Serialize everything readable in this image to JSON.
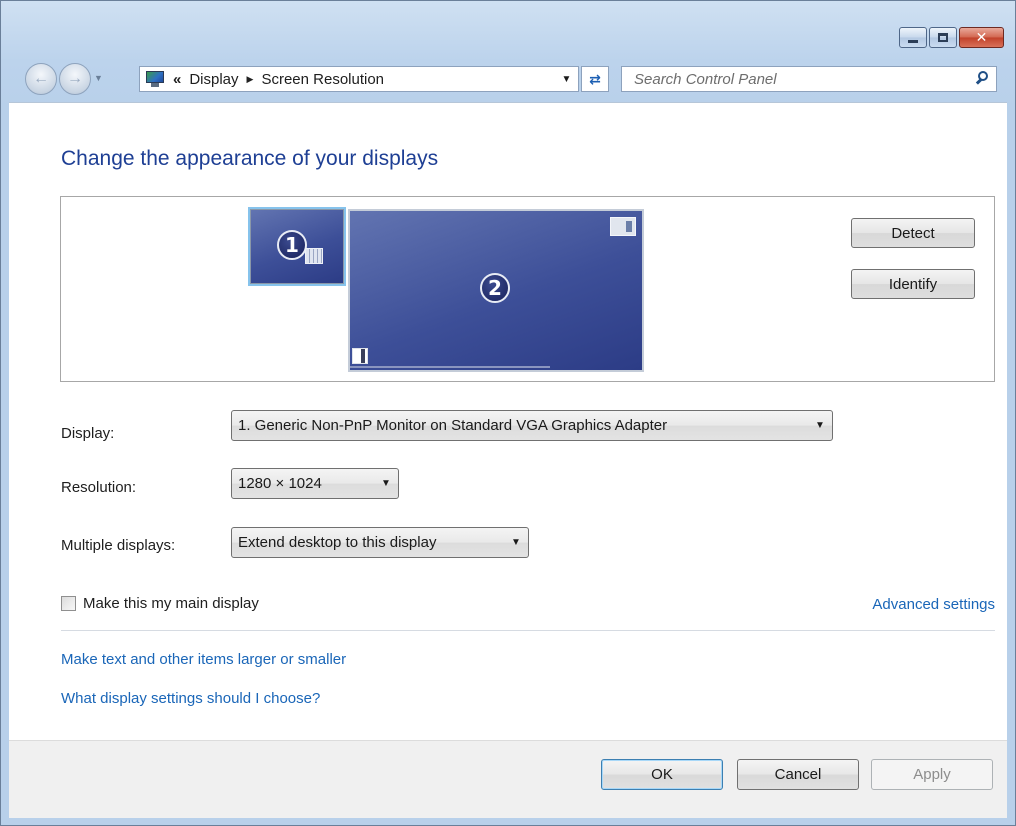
{
  "window": {
    "caption": {
      "close_glyph": "✕"
    }
  },
  "nav": {
    "breadcrumb_chevron": "«",
    "breadcrumbs": [
      "Display",
      "Screen Resolution"
    ],
    "search_placeholder": "Search Control Panel"
  },
  "main": {
    "title": "Change the appearance of your displays",
    "monitors": [
      {
        "number": "1"
      },
      {
        "number": "2"
      }
    ],
    "detect_label": "Detect",
    "identify_label": "Identify",
    "display": {
      "label": "Display:",
      "value": "1. Generic Non-PnP Monitor on Standard VGA Graphics Adapter"
    },
    "resolution": {
      "label": "Resolution:",
      "value": "1280 × 1024"
    },
    "multiple_displays": {
      "label": "Multiple displays:",
      "value": "Extend desktop to this display"
    },
    "main_display_checkbox": {
      "label": "Make this my main display",
      "checked": false
    },
    "advanced_settings_link": "Advanced settings",
    "links": [
      "Make text and other items larger or smaller",
      "What display settings should I choose?"
    ]
  },
  "footer": {
    "ok_label": "OK",
    "cancel_label": "Cancel",
    "apply_label": "Apply"
  },
  "colors": {
    "title_blue": "#1e3f94",
    "link_blue": "#1a66b8",
    "monitor_fill": "#3d4f98"
  }
}
